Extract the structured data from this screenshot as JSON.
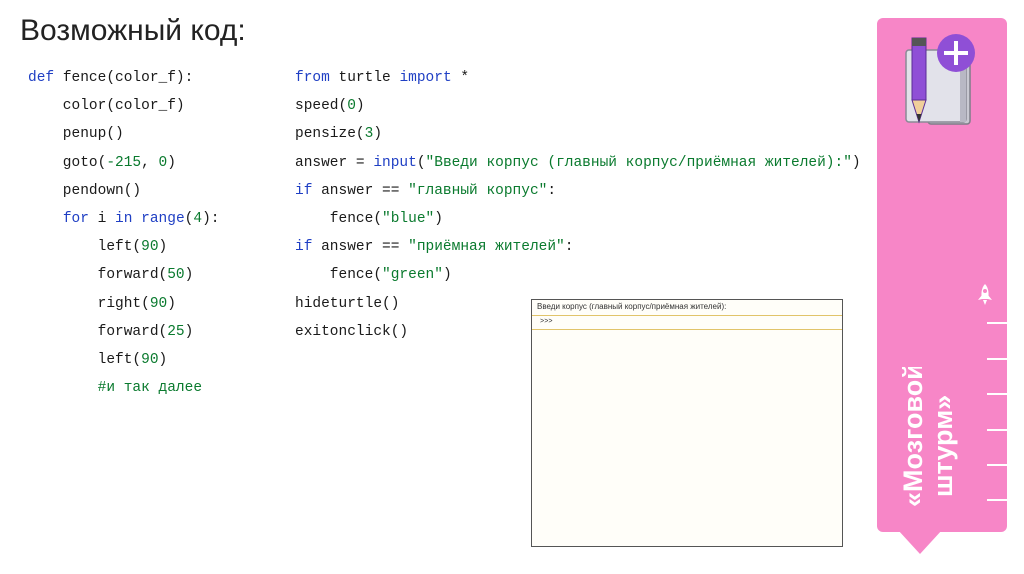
{
  "title": "Возможный код:",
  "code_left": [
    [
      {
        "t": "def ",
        "c": "kw"
      },
      {
        "t": "fence(color_f):",
        "c": ""
      }
    ],
    [
      {
        "t": "    color(color_f)",
        "c": ""
      }
    ],
    [
      {
        "t": "    penup()",
        "c": ""
      }
    ],
    [
      {
        "t": "    goto(",
        "c": ""
      },
      {
        "t": "-215",
        "c": "num"
      },
      {
        "t": ", ",
        "c": ""
      },
      {
        "t": "0",
        "c": "num"
      },
      {
        "t": ")",
        "c": ""
      }
    ],
    [
      {
        "t": "    pendown()",
        "c": ""
      }
    ],
    [
      {
        "t": "    ",
        "c": ""
      },
      {
        "t": "for",
        "c": "kw"
      },
      {
        "t": " i ",
        "c": ""
      },
      {
        "t": "in",
        "c": "kw"
      },
      {
        "t": " ",
        "c": ""
      },
      {
        "t": "range",
        "c": "kw"
      },
      {
        "t": "(",
        "c": ""
      },
      {
        "t": "4",
        "c": "num"
      },
      {
        "t": "):",
        "c": ""
      }
    ],
    [
      {
        "t": "        left(",
        "c": ""
      },
      {
        "t": "90",
        "c": "num"
      },
      {
        "t": ")",
        "c": ""
      }
    ],
    [
      {
        "t": "        forward(",
        "c": ""
      },
      {
        "t": "50",
        "c": "num"
      },
      {
        "t": ")",
        "c": ""
      }
    ],
    [
      {
        "t": "        right(",
        "c": ""
      },
      {
        "t": "90",
        "c": "num"
      },
      {
        "t": ")",
        "c": ""
      }
    ],
    [
      {
        "t": "        forward(",
        "c": ""
      },
      {
        "t": "25",
        "c": "num"
      },
      {
        "t": ")",
        "c": ""
      }
    ],
    [
      {
        "t": "        left(",
        "c": ""
      },
      {
        "t": "90",
        "c": "num"
      },
      {
        "t": ")",
        "c": ""
      }
    ],
    [
      {
        "t": "        #и так далее",
        "c": "cm"
      }
    ]
  ],
  "code_right": [
    [
      {
        "t": "from",
        "c": "kw"
      },
      {
        "t": " turtle ",
        "c": ""
      },
      {
        "t": "import",
        "c": "kw"
      },
      {
        "t": " *",
        "c": ""
      }
    ],
    [
      {
        "t": "speed(",
        "c": ""
      },
      {
        "t": "0",
        "c": "num"
      },
      {
        "t": ")",
        "c": ""
      }
    ],
    [
      {
        "t": "pensize(",
        "c": ""
      },
      {
        "t": "3",
        "c": "num"
      },
      {
        "t": ")",
        "c": ""
      }
    ],
    [
      {
        "t": "answer = ",
        "c": ""
      },
      {
        "t": "input",
        "c": "kw"
      },
      {
        "t": "(",
        "c": ""
      },
      {
        "t": "\"Введи корпус (главный корпус/приёмная жителей):\"",
        "c": "str"
      },
      {
        "t": ")",
        "c": ""
      }
    ],
    [
      {
        "t": "if",
        "c": "kw"
      },
      {
        "t": " answer == ",
        "c": ""
      },
      {
        "t": "\"главный корпус\"",
        "c": "str"
      },
      {
        "t": ":",
        "c": ""
      }
    ],
    [
      {
        "t": "    fence(",
        "c": ""
      },
      {
        "t": "\"blue\"",
        "c": "str"
      },
      {
        "t": ")",
        "c": ""
      }
    ],
    [
      {
        "t": "if",
        "c": "kw"
      },
      {
        "t": " answer == ",
        "c": ""
      },
      {
        "t": "\"приёмная жителей\"",
        "c": "str"
      },
      {
        "t": ":",
        "c": ""
      }
    ],
    [
      {
        "t": "    fence(",
        "c": ""
      },
      {
        "t": "\"green\"",
        "c": "str"
      },
      {
        "t": ")",
        "c": ""
      }
    ],
    [
      {
        "t": "hideturtle()",
        "c": ""
      }
    ],
    [
      {
        "t": "exitonclick()",
        "c": ""
      }
    ]
  ],
  "shell": {
    "prompt_line": "Введи корпус (главный корпус/приёмная жителей):",
    "input_line": ">>>"
  },
  "sidebar": {
    "label_line1": "«Мозговой",
    "label_line2": "штурм»",
    "icon": "notebook-pencil-plus-icon",
    "rocket_icon": "rocket-icon",
    "color": "#f786c7"
  }
}
